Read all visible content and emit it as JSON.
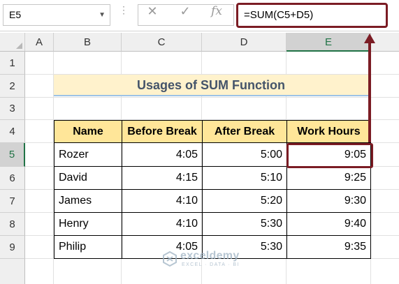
{
  "name_box": {
    "value": "E5"
  },
  "formula_bar": {
    "cancel_icon": "✕",
    "enter_icon": "✓",
    "fx_label": "fx",
    "formula": "=SUM(C5+D5)"
  },
  "columns": [
    "A",
    "B",
    "C",
    "D",
    "E"
  ],
  "rows": [
    "1",
    "2",
    "3",
    "4",
    "5",
    "6",
    "7",
    "8",
    "9"
  ],
  "selected_cell": "E5",
  "sheet": {
    "title": "Usages of SUM Function",
    "table": {
      "headers": [
        "Name",
        "Before Break",
        "After Break",
        "Work Hours"
      ],
      "rows": [
        [
          "Rozer",
          "4:05",
          "5:00",
          "9:05"
        ],
        [
          "David",
          "4:15",
          "5:10",
          "9:25"
        ],
        [
          "James",
          "4:10",
          "5:20",
          "9:30"
        ],
        [
          "Henry",
          "4:10",
          "5:30",
          "9:40"
        ],
        [
          "Philip",
          "4:05",
          "5:30",
          "9:35"
        ]
      ]
    }
  },
  "watermark": {
    "brand": "exceldemy",
    "tagline": "EXCEL · DATA · BI"
  },
  "colors": {
    "highlight": "#7b1c24",
    "header_fill": "#ffe699",
    "title_fill": "#fff2cc",
    "excel_green": "#217346"
  }
}
